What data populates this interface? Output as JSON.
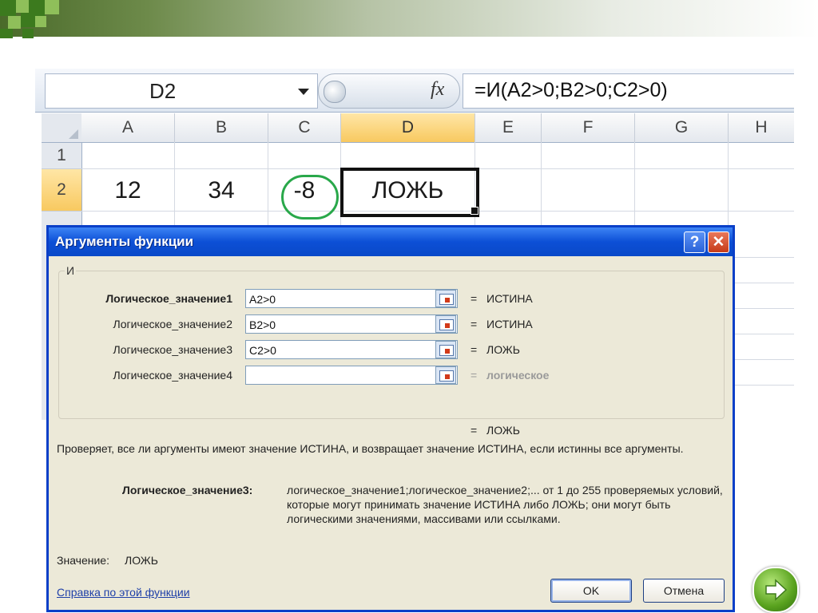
{
  "excel": {
    "name_box": "D2",
    "fx_label": "fx",
    "formula": "=И(A2>0;B2>0;C2>0)",
    "columns": [
      "A",
      "B",
      "C",
      "D",
      "E",
      "F",
      "G",
      "H"
    ],
    "rows": [
      "1",
      "2"
    ],
    "cells": {
      "A2": "12",
      "B2": "34",
      "C2": "-8",
      "D2": "ЛОЖЬ"
    }
  },
  "dialog": {
    "title": "Аргументы функции",
    "help_button": "?",
    "close_button": "✕",
    "function_name": "И",
    "args": [
      {
        "label": "Логическое_значение1",
        "value": "A2>0",
        "result": "ИСТИНА"
      },
      {
        "label": "Логическое_значение2",
        "value": "B2>0",
        "result": "ИСТИНА"
      },
      {
        "label": "Логическое_значение3",
        "value": "C2>0",
        "result": "ЛОЖЬ"
      },
      {
        "label": "Логическое_значение4",
        "value": "",
        "result": "логическое"
      }
    ],
    "equals": "=",
    "overall_result": "ЛОЖЬ",
    "description": "Проверяет, все ли аргументы имеют значение ИСТИНА, и возвращает значение ИСТИНА, если истинны все аргументы.",
    "arg_detail_label": "Логическое_значение3:",
    "arg_detail_text": "логическое_значение1;логическое_значение2;... от 1 до 255 проверяемых условий, которые могут принимать значение ИСТИНА либо ЛОЖЬ; они могут быть логическими значениями, массивами или ссылками.",
    "value_label": "Значение:",
    "value": "ЛОЖЬ",
    "help_link": "Справка по этой функции",
    "ok": "OK",
    "cancel": "Отмена"
  },
  "colors": {
    "dialog_title": "#0a49c8",
    "selected_header": "#f8c960",
    "highlight_circle": "#29a84a"
  }
}
